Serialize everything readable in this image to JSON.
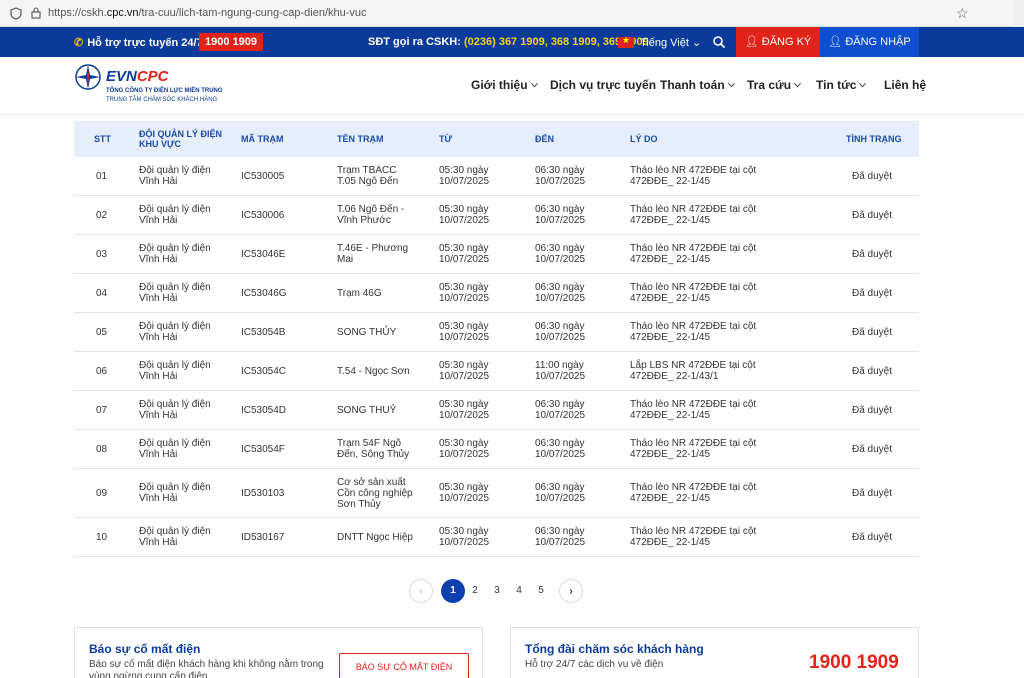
{
  "browser": {
    "url_prefix": "https://cskh.",
    "url_domain": "cpc.vn",
    "url_path": "/tra-cuu/lich-tam-ngung-cung-cap-dien/khu-vuc"
  },
  "topbar": {
    "hotline_label": "Hỗ trợ trực tuyến 24/7:",
    "hotline_number": "1900 1909",
    "cskh_label": "SĐT gọi ra CSKH:",
    "cskh_numbers": "(0236) 367 1909, 368 1909, 369 1909",
    "language": "Tiếng Việt",
    "register": "ĐĂNG KÝ",
    "login": "ĐĂNG NHẬP"
  },
  "header": {
    "logo_evn": "EVN",
    "logo_cpc": "CPC",
    "logo_line1": "TỔNG CÔNG TY ĐIỆN LỰC MIỀN TRUNG",
    "logo_line2": "TRUNG TÂM CHĂM SÓC KHÁCH HÀNG",
    "menu": [
      "Giới thiệu",
      "Dịch vụ trực tuyến",
      "Thanh toán",
      "Tra cứu",
      "Tin tức",
      "Liên hệ"
    ]
  },
  "table": {
    "headers": [
      "STT",
      "ĐỘI QUẢN LÝ ĐIỆN KHU VỰC",
      "MÃ TRẠM",
      "TÊN TRẠM",
      "TỪ",
      "ĐẾN",
      "LÝ DO",
      "TÌNH TRẠNG"
    ],
    "rows": [
      {
        "stt": "01",
        "doi": "Đội quản lý điện Vĩnh Hải",
        "ma": "IC530005",
        "ten": "Trạm TBACC T.05 Ngô Đến",
        "tu": "05:30 ngày 10/07/2025",
        "den": "06:30 ngày 10/07/2025",
        "lydo": "Tháo lèo NR 472ĐĐE tại cột 472ĐĐE_ 22-1/45",
        "tt": "Đã duyệt"
      },
      {
        "stt": "02",
        "doi": "Đội quản lý điện Vĩnh Hải",
        "ma": "IC530006",
        "ten": "T.06 Ngô Đến - Vĩnh Phước",
        "tu": "05:30 ngày 10/07/2025",
        "den": "06:30 ngày 10/07/2025",
        "lydo": "Tháo lèo NR 472ĐĐE tại cột 472ĐĐE_ 22-1/45",
        "tt": "Đã duyệt"
      },
      {
        "stt": "03",
        "doi": "Đội quản lý điện Vĩnh Hải",
        "ma": "IC53046E",
        "ten": "T.46E - Phương Mai",
        "tu": "05:30 ngày 10/07/2025",
        "den": "06:30 ngày 10/07/2025",
        "lydo": "Tháo lèo NR 472ĐĐE tại cột 472ĐĐE_ 22-1/45",
        "tt": "Đã duyệt"
      },
      {
        "stt": "04",
        "doi": "Đội quản lý điện Vĩnh Hải",
        "ma": "IC53046G",
        "ten": "Trạm 46G",
        "tu": "05:30 ngày 10/07/2025",
        "den": "06:30 ngày 10/07/2025",
        "lydo": "Tháo lèo NR 472ĐĐE tại cột 472ĐĐE_ 22-1/45",
        "tt": "Đã duyệt"
      },
      {
        "stt": "05",
        "doi": "Đội quản lý điện Vĩnh Hải",
        "ma": "IC53054B",
        "ten": "SONG THỦY",
        "tu": "05:30 ngày 10/07/2025",
        "den": "06:30 ngày 10/07/2025",
        "lydo": "Tháo lèo NR 472ĐĐE tại cột 472ĐĐE_ 22-1/45",
        "tt": "Đã duyệt"
      },
      {
        "stt": "06",
        "doi": "Đội quản lý điện Vĩnh Hải",
        "ma": "IC53054C",
        "ten": "T.54 - Ngọc Sơn",
        "tu": "05:30 ngày 10/07/2025",
        "den": "11:00 ngày 10/07/2025",
        "lydo": "Lắp LBS NR 472ĐĐE tại cột 472ĐĐE_ 22-1/43/1",
        "tt": "Đã duyệt"
      },
      {
        "stt": "07",
        "doi": "Đội quản lý điện Vĩnh Hải",
        "ma": "IC53054D",
        "ten": "SONG THUỶ",
        "tu": "05:30 ngày 10/07/2025",
        "den": "06:30 ngày 10/07/2025",
        "lydo": "Tháo lèo NR 472ĐĐE tại cột 472ĐĐE_ 22-1/45",
        "tt": "Đã duyệt"
      },
      {
        "stt": "08",
        "doi": "Đội quản lý điện Vĩnh Hải",
        "ma": "IC53054F",
        "ten": "Trạm 54F Ngô Đến, Sông Thủy",
        "tu": "05:30 ngày 10/07/2025",
        "den": "06:30 ngày 10/07/2025",
        "lydo": "Tháo lèo NR 472ĐĐE tại cột 472ĐĐE_ 22-1/45",
        "tt": "Đã duyệt"
      },
      {
        "stt": "09",
        "doi": "Đội quản lý điện Vĩnh Hải",
        "ma": "ID530103",
        "ten": "Cơ sở sản xuất Cồn công nghiệp Sơn Thủy",
        "tu": "05:30 ngày 10/07/2025",
        "den": "06:30 ngày 10/07/2025",
        "lydo": "Tháo lèo NR 472ĐĐE tại cột 472ĐĐE_ 22-1/45",
        "tt": "Đã duyệt"
      },
      {
        "stt": "10",
        "doi": "Đội quản lý điện Vĩnh Hải",
        "ma": "ID530167",
        "ten": "DNTT Ngọc Hiệp",
        "tu": "05:30 ngày 10/07/2025",
        "den": "06:30 ngày 10/07/2025",
        "lydo": "Tháo lèo NR 472ĐĐE tại cột 472ĐĐE_ 22-1/45",
        "tt": "Đã duyệt"
      }
    ]
  },
  "pagination": {
    "pages": [
      "1",
      "2",
      "3",
      "4",
      "5"
    ],
    "current": "1",
    "prev": "‹",
    "next": "›"
  },
  "cards": {
    "report_title": "Báo sự cố mất điện",
    "report_desc": "Báo sự cố mất điện khách hàng khi không nằm trong vùng ngừng cung cấp điện",
    "report_button": "BÁO SỰ CỐ MẤT ĐIỆN",
    "support_title": "Tổng đài chăm sóc khách hàng",
    "support_desc": "Hỗ trợ 24/7 các dịch vụ về điện",
    "support_number": "1900 1909"
  },
  "colors": {
    "navy": "#0b3b9a",
    "red": "#e2231a",
    "blue": "#0e4fd0",
    "table_header_bg": "#e6eefb"
  }
}
